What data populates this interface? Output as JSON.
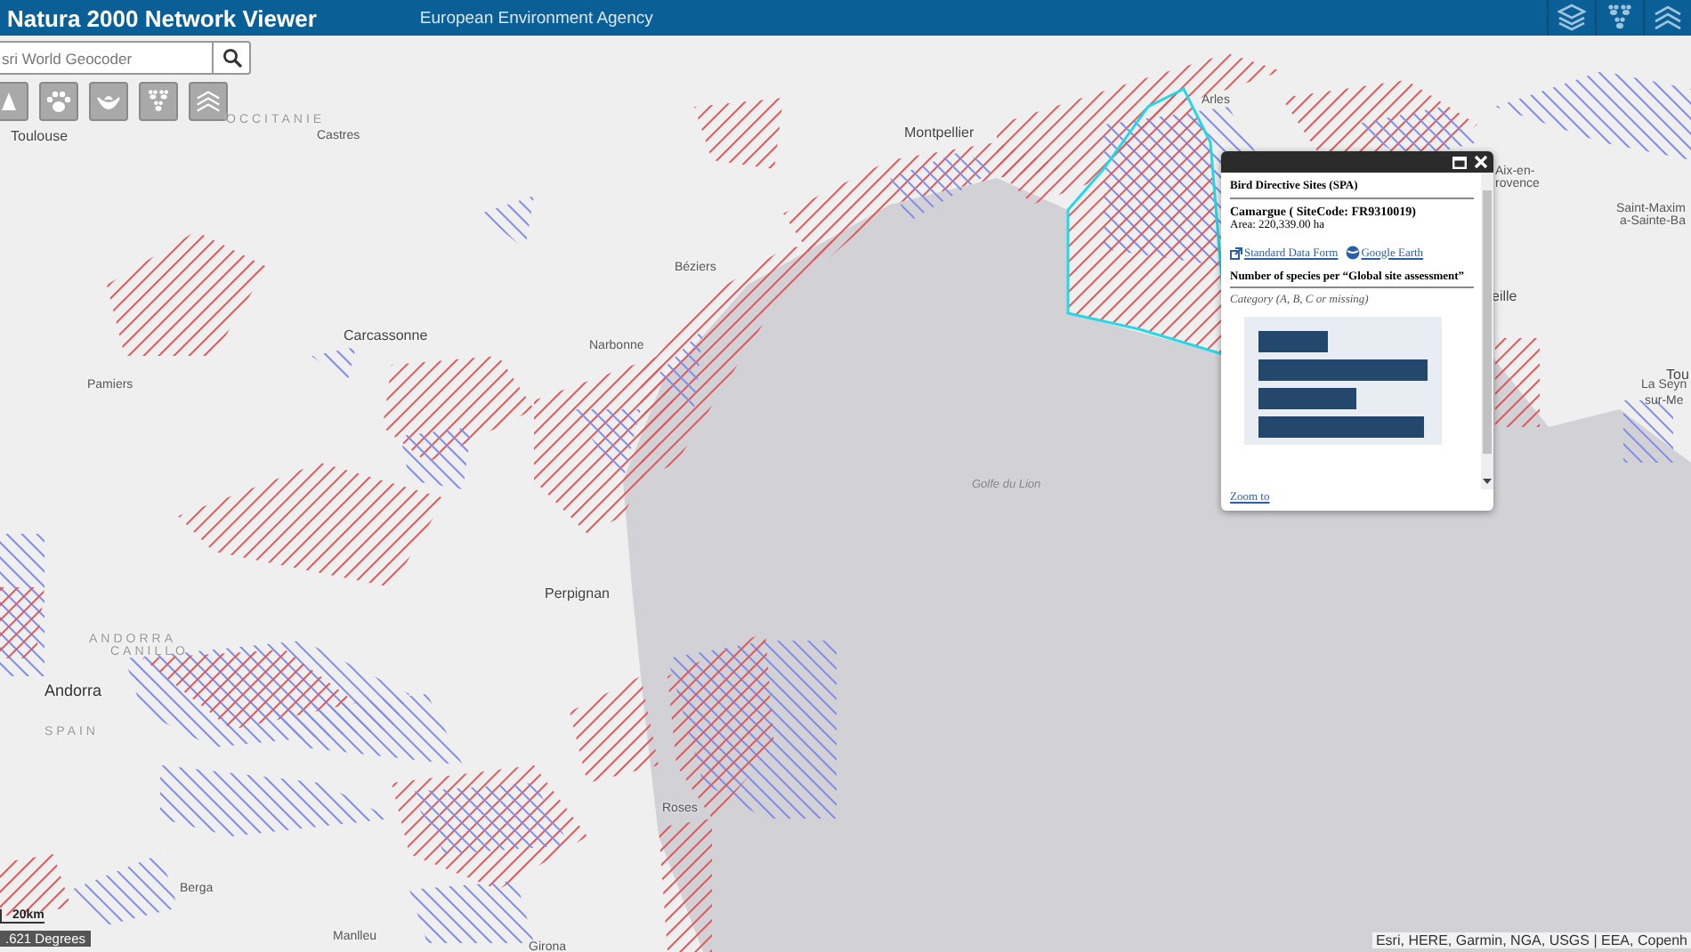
{
  "header": {
    "title": "Natura 2000 Network Viewer",
    "agency": "European Environment Agency"
  },
  "search": {
    "placeholder": "sri World Geocoder"
  },
  "map": {
    "place_labels": [
      {
        "text": "Toulouse",
        "kind": "city"
      },
      {
        "text": "OCCITANIE",
        "kind": "region"
      },
      {
        "text": "Castres",
        "kind": "town"
      },
      {
        "text": "Montpellier",
        "kind": "city"
      },
      {
        "text": "Arles",
        "kind": "town"
      },
      {
        "text": "Aix-en-",
        "kind": "town"
      },
      {
        "text": "rovence",
        "kind": "town"
      },
      {
        "text": "Saint-Maxim",
        "kind": "town"
      },
      {
        "text": "a-Sainte-Ba",
        "kind": "town"
      },
      {
        "text": "Béziers",
        "kind": "town"
      },
      {
        "text": "Carcassonne",
        "kind": "city"
      },
      {
        "text": "Narbonne",
        "kind": "town"
      },
      {
        "text": "eille",
        "kind": "city"
      },
      {
        "text": "Tou",
        "kind": "city"
      },
      {
        "text": "La Seyn",
        "kind": "town"
      },
      {
        "text": "sur-Me",
        "kind": "town"
      },
      {
        "text": "Pamiers",
        "kind": "town"
      },
      {
        "text": "Golfe du Lion",
        "kind": "sea"
      },
      {
        "text": "Perpignan",
        "kind": "city"
      },
      {
        "text": "ANDORRA",
        "kind": "region"
      },
      {
        "text": "CANILLO",
        "kind": "region"
      },
      {
        "text": "Andorra",
        "kind": "country"
      },
      {
        "text": "SPAIN",
        "kind": "region"
      },
      {
        "text": "Roses",
        "kind": "town"
      },
      {
        "text": "Berga",
        "kind": "town"
      },
      {
        "text": "Manlleu",
        "kind": "town"
      },
      {
        "text": "Girona",
        "kind": "town"
      }
    ],
    "scale": "20km",
    "coordinates": ".621 Degrees",
    "attribution": "Esri, HERE, Garmin, NGA, USGS | EEA, Copenh"
  },
  "popup": {
    "layer": "Bird Directive Sites (SPA)",
    "site": "Camargue  ( SiteCode: FR9310019)",
    "area": "Area: 220,339.00 ha",
    "links": [
      {
        "text": "Standard Data Form",
        "kind": "external"
      },
      {
        "text": "Google Earth",
        "kind": "globe"
      }
    ],
    "chart_title": "Number of species per “Global site assessment”",
    "category": "Category (A, B, C or missing)",
    "zoom": "Zoom to"
  }
}
